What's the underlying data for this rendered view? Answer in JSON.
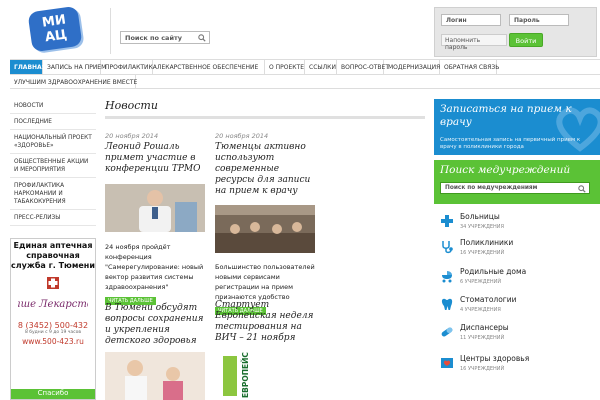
{
  "logo": {
    "line1": "МИ",
    "line2": "АЦ"
  },
  "search": {
    "placeholder": "Поиск по сайту"
  },
  "login": {
    "login_placeholder": "Логин",
    "password_placeholder": "Пароль",
    "remind_label": "Напомнить пароль",
    "enter_label": "Войти"
  },
  "nav": {
    "row1": [
      "Главная",
      "Запись на прием",
      "Профилактика",
      "Лекарственное обеспечение",
      "О проекте",
      "Ссылки",
      "Вопрос-ответ",
      "Модернизация",
      "Обратная связь"
    ],
    "row2": [
      "Улучшим здравоохранение вместе"
    ]
  },
  "left_menu": [
    "Новости",
    "Последние",
    "Национальный проект «Здоровье»",
    "Общественные акции и мероприятия",
    "Профилактика наркомании и табакокурения",
    "Пресс-релизы"
  ],
  "ad": {
    "title": "Единая аптечная справочная служба г. Тюмени",
    "brand": "Ваше Лекарство",
    "phone": "8 (3452) 500-432",
    "hours": "8 будни с 9 до 19 часов",
    "site": "www.500-423.ru",
    "bottom": "Спасибо"
  },
  "news": {
    "title": "Новости",
    "col1": {
      "date": "20 ноября 2014",
      "headline": "Леонид Рошаль примет участие в конференции ТРМО",
      "text": "24 ноября пройдёт конференция \"Самерегулирование: новый вектор развития системы здравоохранения\"",
      "read_more": "Читать дальше",
      "next_headline": "В Тюмени обсудят вопросы сохранения и укрепления детского здоровья"
    },
    "col2": {
      "date": "20 ноября 2014",
      "headline": "Тюменцы активно используют современные ресурсы для записи на прием к врачу",
      "text": "Большинство пользователей новыми сервисами регистрации на прием признаются удобство",
      "read_more": "Читать дальше",
      "next_headline": "Стартует Европейская неделя тестирования на ВИЧ – 21 ноября",
      "poster": "ЕВРОПЕЙСКАЯ НЕДЕЛЯ ТЕСТИРОВАНИЯ НА ВИЧ"
    }
  },
  "appointment": {
    "title": "Записаться на прием к врачу",
    "subtitle": "Самостоятельная запись на первичный прием к врачу в поликлиники города"
  },
  "facility_search": {
    "title": "Поиск медучреждений",
    "placeholder": "Поиск по медучреждениям"
  },
  "categories": [
    {
      "name": "Больницы",
      "count": "34 учреждения",
      "icon": "hospital-cross-icon"
    },
    {
      "name": "Поликлиники",
      "count": "16 учреждений",
      "icon": "stethoscope-icon"
    },
    {
      "name": "Родильные дома",
      "count": "6 учреждений",
      "icon": "baby-carriage-icon"
    },
    {
      "name": "Стоматологии",
      "count": "4 учреждения",
      "icon": "tooth-icon"
    },
    {
      "name": "Диспансеры",
      "count": "11 учреждений",
      "icon": "pill-icon"
    },
    {
      "name": "Центры здоровья",
      "count": "16 учреждений",
      "icon": "heart-book-icon"
    }
  ],
  "colors": {
    "accent_blue": "#1b8dd0",
    "accent_green": "#5bc236"
  }
}
